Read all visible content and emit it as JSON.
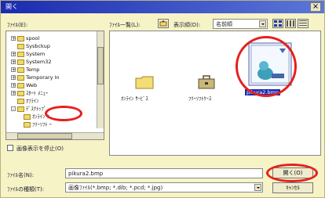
{
  "dialog": {
    "title": "開く",
    "close_glyph": "×"
  },
  "top": {
    "look_in_label": "ﾌｧｲﾙ(E):",
    "file_list_label": "ﾌｧｲﾙ一覧(L):",
    "view_mode_label": "表示順(D):",
    "sort_value": "名前順"
  },
  "tree": {
    "items": [
      {
        "label": "spool",
        "expander": "+"
      },
      {
        "label": "Sysbckup",
        "expander": ""
      },
      {
        "label": "System",
        "expander": "+"
      },
      {
        "label": "System32",
        "expander": "+"
      },
      {
        "label": "Temp",
        "expander": "+"
      },
      {
        "label": "Temporary In",
        "expander": "+"
      },
      {
        "label": "Web",
        "expander": "+"
      },
      {
        "label": "ｽﾀｰﾄ ﾒﾆｭｰ",
        "expander": "+"
      },
      {
        "label": "ｵﾌﾗｲﾝ",
        "expander": ""
      },
      {
        "label": "ﾃﾞｽｸﾄｯﾌﾟ",
        "expander": "-"
      },
      {
        "label": "ｵﾝﾗｲﾝ ｻ",
        "expander": ""
      },
      {
        "label": "ﾌﾘｰｿﾌﾄ ｰ",
        "expander": ""
      }
    ]
  },
  "files": [
    {
      "name": "ｵﾝﾗｲﾝ ｻｰﾋﾞｽ",
      "icon": "folder-icon"
    },
    {
      "name": "ﾌﾘｰｿﾌﾄｹｰｽ",
      "icon": "briefcase-icon"
    },
    {
      "name": "pikura2.bmp",
      "icon": "bitmap-thumbnail-icon",
      "selected": true
    }
  ],
  "preview_checkbox_label": "画像表示を停止(O)",
  "bottom": {
    "filename_label": "ﾌｧｲﾙ名(N):",
    "filename_value": "pikura2.bmp",
    "filetype_label": "ﾌｧｲﾙの種類(T):",
    "filetype_value": "画像ﾌｧｲﾙ(*.bmp; *.dib; *.pcd; *.jpg)",
    "open_button": "開く(O)",
    "cancel_button": "ｷｬﾝｾﾙ"
  },
  "colors": {
    "highlight": "#e5201d",
    "title_bar": "#1a2bb0",
    "dialog_bg": "#f6f3c6"
  }
}
